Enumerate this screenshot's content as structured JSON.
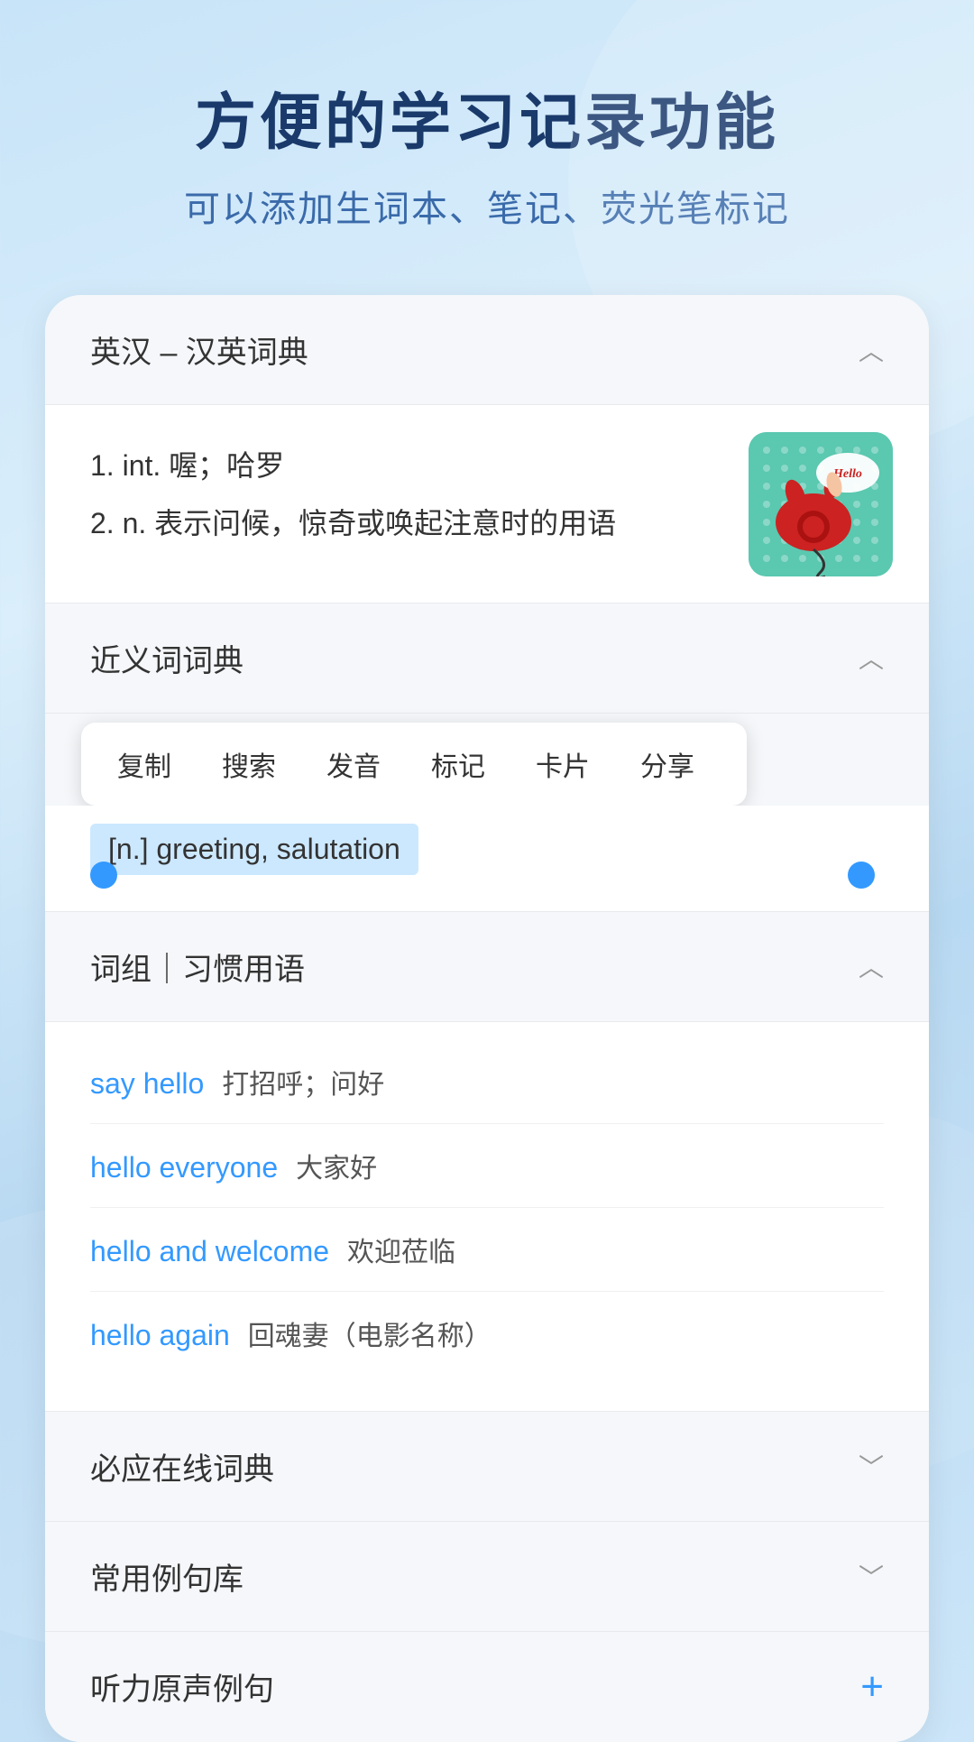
{
  "header": {
    "title": "方便的学习记录功能",
    "subtitle": "可以添加生词本、笔记、荧光笔标记"
  },
  "sections": {
    "dictionary": {
      "title": "英汉 – 汉英词典",
      "entries": [
        {
          "index": "1.",
          "type": "int.",
          "definition": "喔；哈罗"
        },
        {
          "index": "2.",
          "type": "n.",
          "definition": "表示问候，惊奇或唤起注意时的用语"
        }
      ]
    },
    "synonyms": {
      "title": "近义词词典",
      "context_menu": [
        "复制",
        "搜索",
        "发音",
        "标记",
        "卡片",
        "分享"
      ],
      "selected_text": "[n.] greeting, salutation"
    },
    "phrases": {
      "title": "词组｜习惯用语",
      "items": [
        {
          "english": "say hello",
          "chinese": "打招呼；问好"
        },
        {
          "english": "hello everyone",
          "chinese": "大家好"
        },
        {
          "english": "hello and welcome",
          "chinese": "欢迎莅临"
        },
        {
          "english": "hello again",
          "chinese": "回魂妻（电影名称）"
        }
      ]
    },
    "online_dict": {
      "title": "必应在线词典"
    },
    "example_sentences": {
      "title": "常用例句库"
    },
    "listening": {
      "title": "听力原声例句"
    }
  },
  "icons": {
    "chevron_up": "∧",
    "chevron_down": "∨",
    "plus": "+"
  }
}
